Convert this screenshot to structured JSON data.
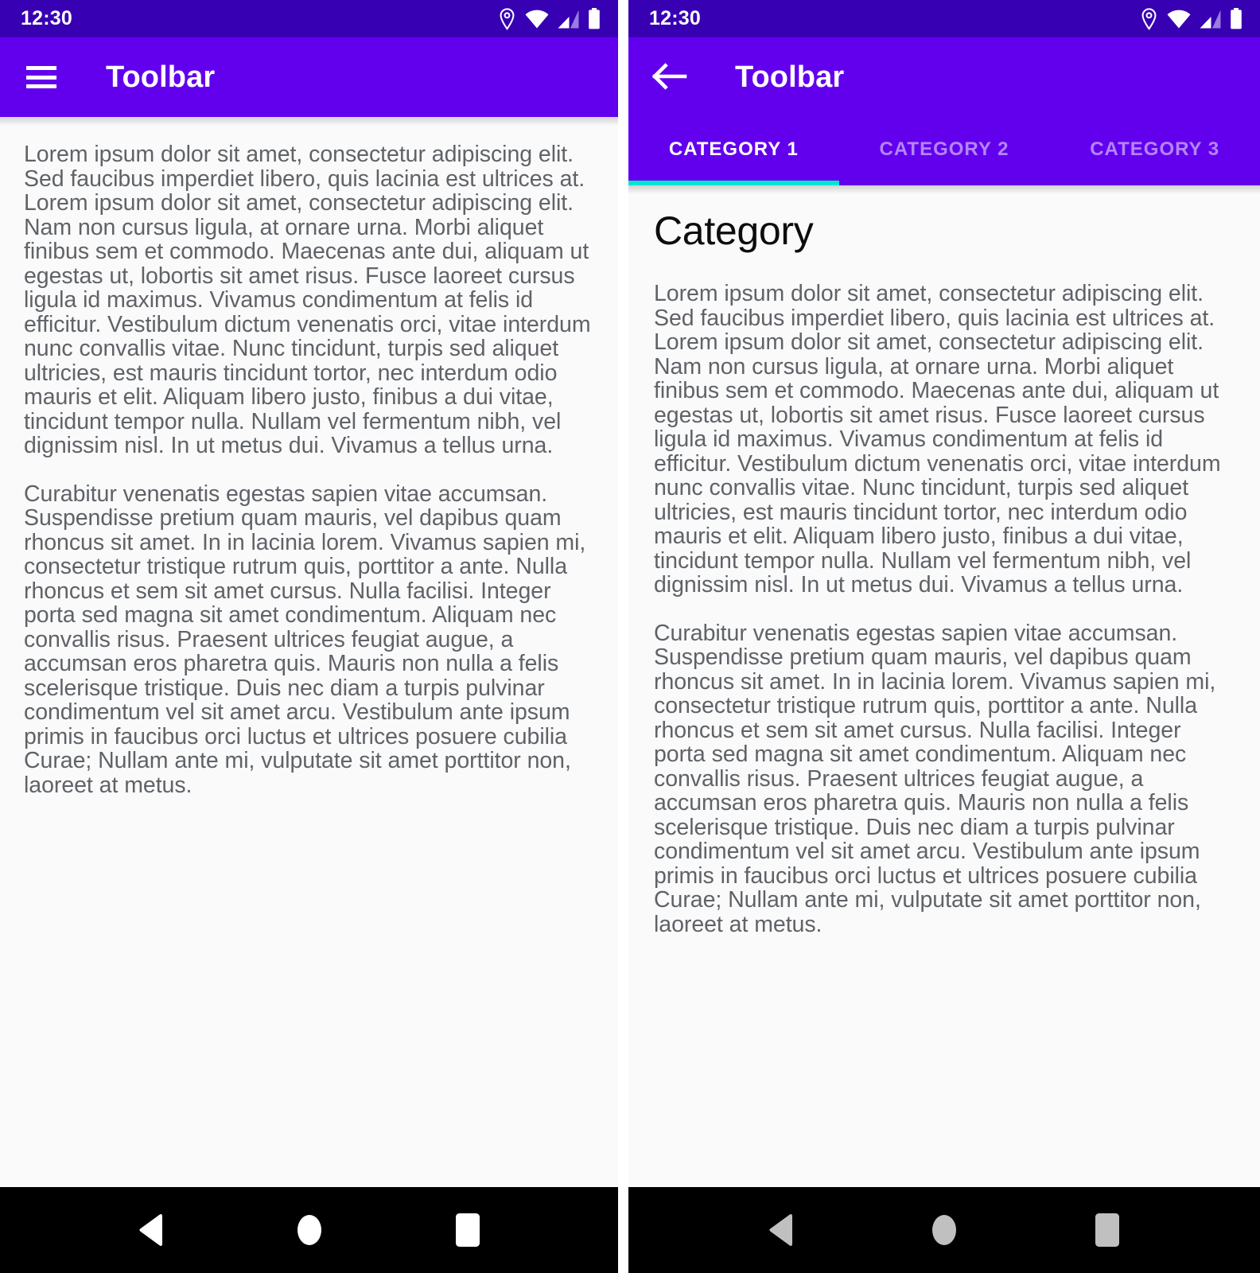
{
  "colors": {
    "status_bar": "#3700B3",
    "toolbar": "#6200EE",
    "tab_indicator": "#00E6D0",
    "content_bg": "#FAFAFA",
    "body_text": "#5F6368",
    "nav_bar": "#000000",
    "nav_icon_left": "#FFFFFF",
    "nav_icon_right": "#C0C0C0"
  },
  "left_screen": {
    "status_bar": {
      "time": "12:30",
      "icons": [
        "location-pin-icon",
        "wifi-icon",
        "cellular-signal-icon",
        "battery-icon"
      ]
    },
    "toolbar": {
      "nav_icon": "hamburger-menu-icon",
      "title": "Toolbar"
    },
    "content": {
      "paragraphs": [
        "Lorem ipsum dolor sit amet, consectetur adipiscing elit. Sed faucibus imperdiet libero, quis lacinia est ultrices at. Lorem ipsum dolor sit amet, consectetur adipiscing elit. Nam non cursus ligula, at ornare urna. Morbi aliquet finibus sem et commodo. Maecenas ante dui, aliquam ut egestas ut, lobortis sit amet risus. Fusce laoreet cursus ligula id maximus. Vivamus condimentum at felis id efficitur. Vestibulum dictum venenatis orci, vitae interdum nunc convallis vitae. Nunc tincidunt, turpis sed aliquet ultricies, est mauris tincidunt tortor, nec interdum odio mauris et elit. Aliquam libero justo, finibus a dui vitae, tincidunt tempor nulla. Nullam vel fermentum nibh, vel dignissim nisl. In ut metus dui. Vivamus a tellus urna.",
        "Curabitur venenatis egestas sapien vitae accumsan. Suspendisse pretium quam mauris, vel dapibus quam rhoncus sit amet. In in lacinia lorem. Vivamus sapien mi, consectetur tristique rutrum quis, porttitor a ante. Nulla rhoncus et sem sit amet cursus. Nulla facilisi. Integer porta sed magna sit amet condimentum. Aliquam nec convallis risus. Praesent ultrices feugiat augue, a accumsan eros pharetra quis. Mauris non nulla a felis scelerisque tristique. Duis nec diam a turpis pulvinar condimentum vel sit amet arcu. Vestibulum ante ipsum primis in faucibus orci luctus et ultrices posuere cubilia Curae; Nullam ante mi, vulputate sit amet porttitor non, laoreet at metus."
      ]
    },
    "nav_bar": {
      "back_label": "Back",
      "home_label": "Home",
      "recents_label": "Recents"
    }
  },
  "right_screen": {
    "status_bar": {
      "time": "12:30",
      "icons": [
        "location-pin-icon",
        "wifi-icon",
        "cellular-signal-icon",
        "battery-icon"
      ]
    },
    "toolbar": {
      "nav_icon": "back-arrow-icon",
      "title": "Toolbar"
    },
    "tabs": [
      {
        "label": "CATEGORY 1",
        "active": true
      },
      {
        "label": "CATEGORY 2",
        "active": false
      },
      {
        "label": "CATEGORY 3",
        "active": false
      }
    ],
    "content": {
      "heading": "Category",
      "paragraphs": [
        "Lorem ipsum dolor sit amet, consectetur adipiscing elit. Sed faucibus imperdiet libero, quis lacinia est ultrices at. Lorem ipsum dolor sit amet, consectetur adipiscing elit. Nam non cursus ligula, at ornare urna. Morbi aliquet finibus sem et commodo. Maecenas ante dui, aliquam ut egestas ut, lobortis sit amet risus. Fusce laoreet cursus ligula id maximus. Vivamus condimentum at felis id efficitur. Vestibulum dictum venenatis orci, vitae interdum nunc convallis vitae. Nunc tincidunt, turpis sed aliquet ultricies, est mauris tincidunt tortor, nec interdum odio mauris et elit. Aliquam libero justo, finibus a dui vitae, tincidunt tempor nulla. Nullam vel fermentum nibh, vel dignissim nisl. In ut metus dui. Vivamus a tellus urna.",
        "Curabitur venenatis egestas sapien vitae accumsan. Suspendisse pretium quam mauris, vel dapibus quam rhoncus sit amet. In in lacinia lorem. Vivamus sapien mi, consectetur tristique rutrum quis, porttitor a ante. Nulla rhoncus et sem sit amet cursus. Nulla facilisi. Integer porta sed magna sit amet condimentum. Aliquam nec convallis risus. Praesent ultrices feugiat augue, a accumsan eros pharetra quis. Mauris non nulla a felis scelerisque tristique. Duis nec diam a turpis pulvinar condimentum vel sit amet arcu. Vestibulum ante ipsum primis in faucibus orci luctus et ultrices posuere cubilia Curae; Nullam ante mi, vulputate sit amet porttitor non, laoreet at metus."
      ]
    },
    "nav_bar": {
      "back_label": "Back",
      "home_label": "Home",
      "recents_label": "Recents"
    }
  }
}
